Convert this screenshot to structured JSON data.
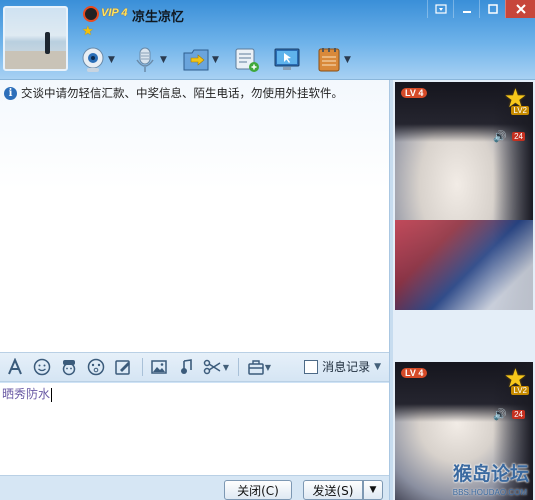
{
  "header": {
    "vip_label": "VIP 4",
    "nickname": "凉生凉忆"
  },
  "window_controls": [
    "menu-down",
    "minimize",
    "maximize",
    "close"
  ],
  "toolbar_icons": [
    "webcam-icon",
    "microphone-icon",
    "send-file-icon",
    "app-icon",
    "remote-assist-icon",
    "notebook-icon"
  ],
  "chat": {
    "notice": "交谈中请勿轻信汇款、中奖信息、陌生电话，勿使用外挂软件。"
  },
  "input_toolbar": {
    "icons": [
      "font-icon",
      "emoji-icon",
      "gift-face-icon",
      "magic-face-icon",
      "doodle-icon",
      "image-icon",
      "music-icon",
      "scissors-icon",
      "toolbox-icon"
    ],
    "history_label": "消息记录"
  },
  "input": {
    "value": "晒秀防水"
  },
  "bottom": {
    "close_label": "关闭(C)",
    "send_label": "发送(S)"
  },
  "side": {
    "top_level_badge": "LV 4",
    "top_star_level": "LV2",
    "top_count": "24",
    "bottom_level_badge": "LV 4",
    "bottom_star_level": "LV2",
    "bottom_count": "24",
    "watermark": "猴岛论坛",
    "watermark_url": "BBS.HOUDAO.COM"
  },
  "colors": {
    "title_blue": "#3a8fd8",
    "panel_blue": "#cfe3f6",
    "vip_gold": "#ffe45c"
  }
}
